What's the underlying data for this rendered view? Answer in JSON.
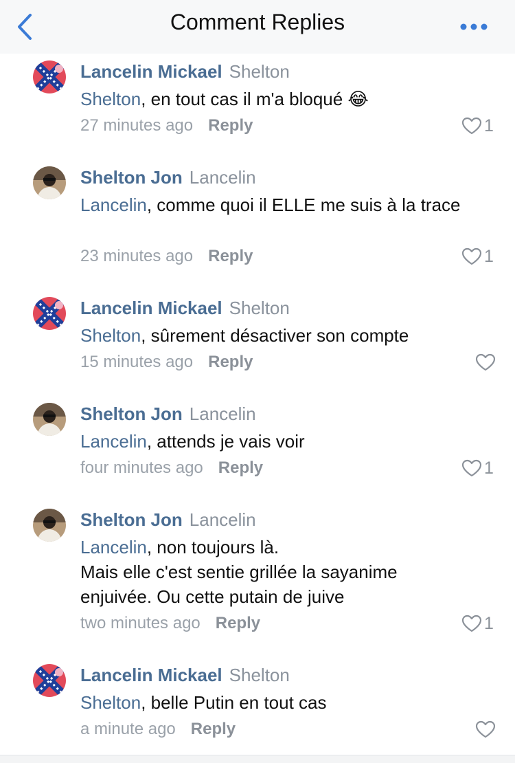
{
  "header": {
    "title": "Comment Replies"
  },
  "comments": [
    {
      "author": "Lancelin Mickael",
      "reply_to": "Shelton",
      "mention": "Shelton",
      "text": ", en tout cas il m'a bloqué 😂",
      "time": "27 minutes ago",
      "reply": "Reply",
      "likes": "1",
      "avatar": "flag-avatar"
    },
    {
      "author": "Shelton Jon",
      "reply_to": "Lancelin",
      "mention": "Lancelin",
      "text": ", comme quoi il ELLE me suis à la trace",
      "time": "23 minutes ago",
      "reply": "Reply",
      "likes": "1",
      "avatar": "person-avatar"
    },
    {
      "author": "Lancelin Mickael",
      "reply_to": "Shelton",
      "mention": "Shelton",
      "text": ", sûrement désactiver son compte",
      "time": "15 minutes ago",
      "reply": "Reply",
      "likes": "",
      "avatar": "flag-avatar"
    },
    {
      "author": "Shelton Jon",
      "reply_to": "Lancelin",
      "mention": "Lancelin",
      "text": ", attends je vais voir",
      "time": "four minutes ago",
      "reply": "Reply",
      "likes": "1",
      "avatar": "person-avatar"
    },
    {
      "author": "Shelton Jon",
      "reply_to": "Lancelin",
      "mention": "Lancelin",
      "text": ", non toujours là.\nMais elle c'est sentie grillée la sayanime enjuivée. Ou cette putain de juive",
      "time": "two minutes ago",
      "reply": "Reply",
      "likes": "1",
      "avatar": "person-avatar"
    },
    {
      "author": "Lancelin Mickael",
      "reply_to": "Shelton",
      "mention": "Shelton",
      "text": ", belle Putin en tout cas",
      "time": "a minute ago",
      "reply": "Reply",
      "likes": "",
      "avatar": "flag-avatar"
    }
  ]
}
